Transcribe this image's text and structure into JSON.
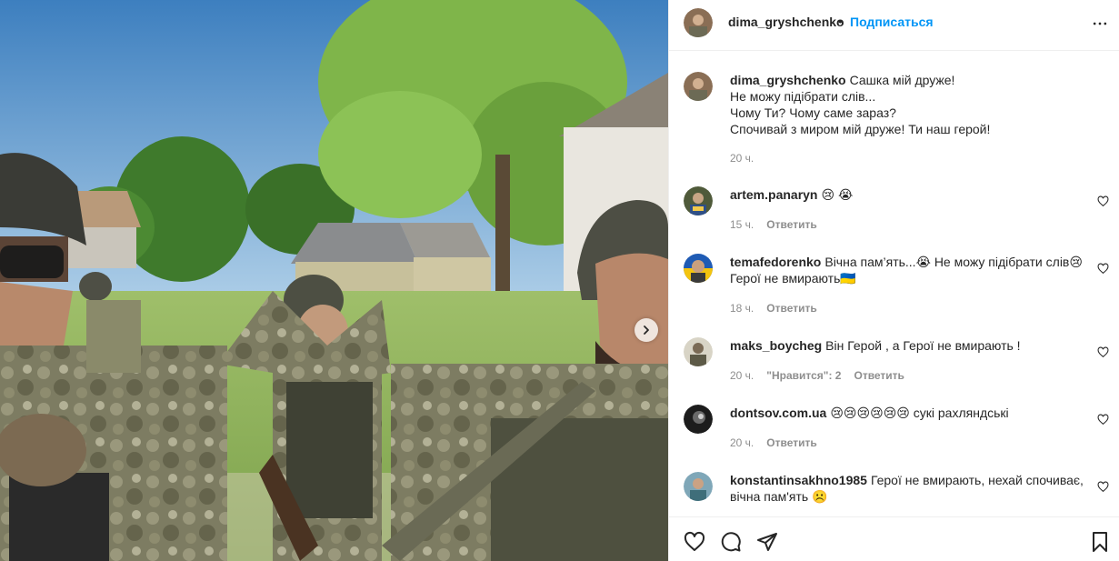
{
  "post": {
    "author": "dima_gryshchenko",
    "separator": "•",
    "follow_label": "Подписаться",
    "more_icon": "more-horizontal-icon",
    "carousel_next_icon": "chevron-right-icon"
  },
  "caption": {
    "user": "dima_gryshchenko",
    "lines": [
      "Сашка мій друже!",
      "Не можу підібрати слів...",
      "Чому Ти? Чому саме зараз?",
      "Спочивай з миром мій друже! Ти наш герой!"
    ],
    "time": "20 ч."
  },
  "comments": [
    {
      "user": "artem.panaryn",
      "line1": "😢 😭",
      "line2": "",
      "time": "15 ч.",
      "likes": "",
      "reply": "Ответить"
    },
    {
      "user": "temafedorenko",
      "line1": "Вічна пам’ять...😭 Не можу підібрати слів😢",
      "line2": "Герої не вмирають🇺🇦",
      "time": "18 ч.",
      "likes": "",
      "reply": "Ответить"
    },
    {
      "user": "maks_boycheg",
      "line1": "Він Герой , а Герої не вмирають !",
      "line2": "",
      "time": "20 ч.",
      "likes": "\"Нравится\": 2",
      "reply": "Ответить"
    },
    {
      "user": "dontsov.com.ua",
      "line1": "😢😢😢😢😢😢 сукі рахляндські",
      "line2": "",
      "time": "20 ч.",
      "likes": "",
      "reply": "Ответить"
    },
    {
      "user": "konstantinsakhno1985",
      "line1": "Герої не вмирають, нехай спочиває,",
      "line2": "вічна пам'ять ☹️",
      "time": "",
      "likes": "",
      "reply": ""
    }
  ],
  "actions": {
    "like_icon": "heart-icon",
    "comment_icon": "comment-icon",
    "share_icon": "send-icon",
    "save_icon": "bookmark-icon"
  },
  "colors": {
    "link_blue": "#0095f6",
    "muted": "#8e8e8e",
    "text": "#262626",
    "divider": "#efefef"
  }
}
